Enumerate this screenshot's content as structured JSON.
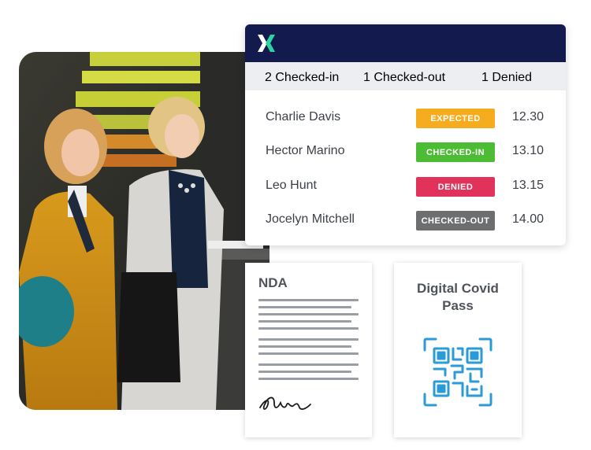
{
  "photo": {
    "alt_icon": "reception-photo"
  },
  "card": {
    "logo_icon": "x-logo-icon",
    "colors": {
      "header": "#131a4e",
      "logo_a": "#ffffff",
      "logo_b": "#2dd4a3"
    },
    "stats": [
      {
        "num": "2",
        "label": "Checked-in"
      },
      {
        "num": "1",
        "label": "Checked-out"
      },
      {
        "num": "1",
        "label": "Denied"
      }
    ],
    "visitors": [
      {
        "name": "Charlie Davis",
        "status": "EXPECTED",
        "color": "#f5ac1e",
        "time": "12.30"
      },
      {
        "name": "Hector Marino",
        "status": "CHECKED-IN",
        "color": "#4cbc34",
        "time": "13.10"
      },
      {
        "name": "Leo Hunt",
        "status": "DENIED",
        "color": "#e0325b",
        "time": "13.15"
      },
      {
        "name": "Jocelyn Mitchell",
        "status": "CHECKED-OUT",
        "color": "#6d6e70",
        "time": "14.00"
      }
    ]
  },
  "nda": {
    "title": "NDA",
    "signature_icon": "signature-icon"
  },
  "covid": {
    "title_line1": "Digital Covid",
    "title_line2": "Pass",
    "qr_icon": "qr-code-icon",
    "qr_color": "#2a9bd6"
  }
}
